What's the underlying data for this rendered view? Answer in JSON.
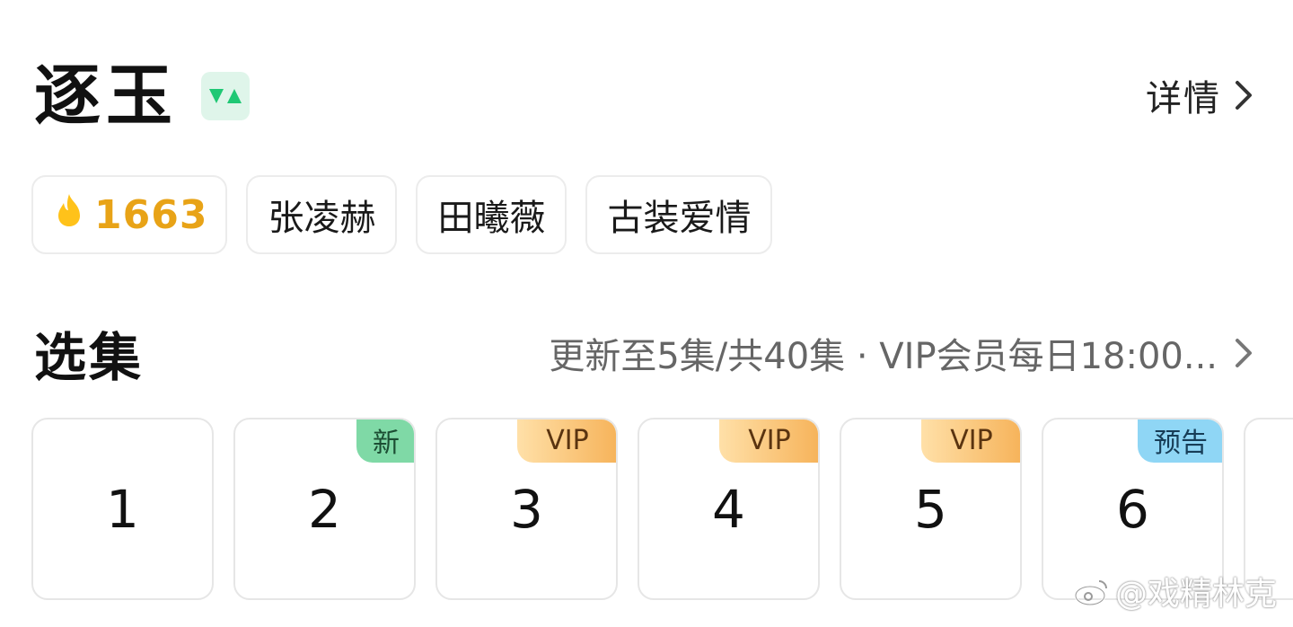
{
  "header": {
    "title": "逐玉",
    "platform_icon": "iqiyi-logo-icon",
    "detail_label": "详情"
  },
  "tags": {
    "hot_count": "1663",
    "hot_icon": "flame-icon",
    "items": [
      "张凌赫",
      "田曦薇",
      "古装爱情"
    ]
  },
  "episodes": {
    "section_title": "选集",
    "update_info": "更新至5集/共40集 · VIP会员每日18:00...",
    "list": [
      {
        "number": "1",
        "badge": ""
      },
      {
        "number": "2",
        "badge": "新"
      },
      {
        "number": "3",
        "badge": "VIP"
      },
      {
        "number": "4",
        "badge": "VIP"
      },
      {
        "number": "5",
        "badge": "VIP"
      },
      {
        "number": "6",
        "badge": "预告"
      }
    ]
  },
  "watermark": {
    "text": "@戏精林克"
  },
  "colors": {
    "hot": "#e8a317",
    "badge_new": "#7fd9a6",
    "badge_vip": "#f6b35a",
    "badge_preview": "#8fd6f5",
    "platform_green": "#1fc874"
  }
}
